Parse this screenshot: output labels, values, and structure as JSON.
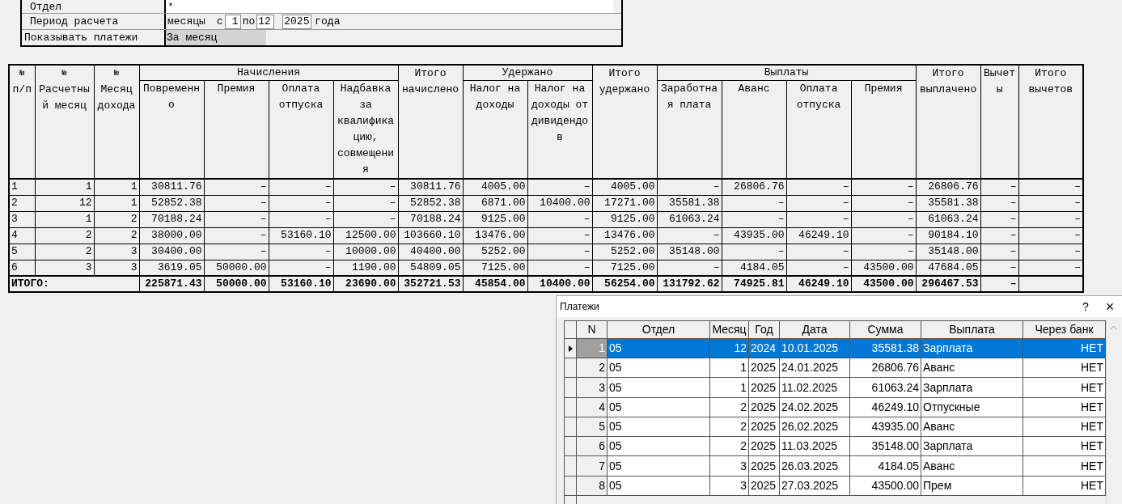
{
  "filter_form": {
    "department": {
      "label": "Отдел",
      "value": "*"
    },
    "period": {
      "label": "Период расчета",
      "months_text": "месяцы",
      "from_text": "с",
      "from": "1",
      "to_text": "по",
      "to": "12",
      "year": "2025",
      "year_text": "года"
    },
    "show_payments": {
      "label": "Показывать платежи",
      "value": "За месяц"
    }
  },
  "report_table": {
    "header_rows": [
      [
        {
          "prefix": "№",
          "label": "п/п",
          "rowspan": 2
        },
        {
          "prefix": "№",
          "label": "Расчетный месяц",
          "rowspan": 2
        },
        {
          "prefix": "№",
          "label": "Месяц дохода",
          "rowspan": 2
        },
        {
          "label": "Начисления",
          "colspan": 4
        },
        {
          "label": "Итого начислено",
          "rowspan": 2
        },
        {
          "label": "Удержано",
          "colspan": 2
        },
        {
          "label": "Итого удержано",
          "rowspan": 2
        },
        {
          "label": "Выплаты",
          "colspan": 4
        },
        {
          "label": "Итого выплачено",
          "rowspan": 2
        },
        {
          "label": "Вычеты",
          "rowspan": 2
        },
        {
          "label": "Итого вычетов",
          "rowspan": 2
        }
      ],
      [
        {
          "label": "Повременно"
        },
        {
          "label": "Премия"
        },
        {
          "label": "Оплата отпуска"
        },
        {
          "label": "Надбавка за квалификацию, совмещения"
        },
        {
          "label": "Налог на доходы"
        },
        {
          "label": "Налог на доходы от дивидендов"
        },
        {
          "label": "Заработная плата"
        },
        {
          "label": "Аванс"
        },
        {
          "label": "Оплата отпуска"
        },
        {
          "label": "Премия"
        }
      ]
    ],
    "rows": [
      [
        "1",
        "1",
        "1",
        "30811.76",
        "–",
        "–",
        "–",
        "30811.76",
        "4005.00",
        "–",
        "4005.00",
        "–",
        "26806.76",
        "–",
        "–",
        "26806.76",
        "–",
        "–"
      ],
      [
        "2",
        "12",
        "1",
        "52852.38",
        "–",
        "–",
        "–",
        "52852.38",
        "6871.00",
        "10400.00",
        "17271.00",
        "35581.38",
        "–",
        "–",
        "–",
        "35581.38",
        "–",
        "–"
      ],
      [
        "3",
        "1",
        "2",
        "70188.24",
        "–",
        "–",
        "–",
        "70188.24",
        "9125.00",
        "–",
        "9125.00",
        "61063.24",
        "–",
        "–",
        "–",
        "61063.24",
        "–",
        "–"
      ],
      [
        "4",
        "2",
        "2",
        "38000.00",
        "–",
        "53160.10",
        "12500.00",
        "103660.10",
        "13476.00",
        "–",
        "13476.00",
        "–",
        "43935.00",
        "46249.10",
        "–",
        "90184.10",
        "–",
        "–"
      ],
      [
        "5",
        "2",
        "3",
        "30400.00",
        "–",
        "–",
        "10000.00",
        "40400.00",
        "5252.00",
        "–",
        "5252.00",
        "35148.00",
        "–",
        "–",
        "–",
        "35148.00",
        "–",
        "–"
      ],
      [
        "6",
        "3",
        "3",
        "3619.05",
        "50000.00",
        "–",
        "1190.00",
        "54809.05",
        "7125.00",
        "–",
        "7125.00",
        "–",
        "4184.05",
        "–",
        "43500.00",
        "47684.05",
        "–",
        "–"
      ]
    ],
    "total": {
      "label": "ИТОГО:",
      "values": [
        "225871.43",
        "50000.00",
        "53160.10",
        "23690.00",
        "352721.53",
        "45854.00",
        "10400.00",
        "56254.00",
        "131792.62",
        "74925.81",
        "46249.10",
        "43500.00",
        "296467.53",
        "–"
      ]
    }
  },
  "payments_dialog": {
    "title": "Платежи",
    "help": "?",
    "close": "×",
    "columns": [
      "N",
      "Отдел",
      "Месяц",
      "Год",
      "Дата",
      "Сумма",
      "Выплата",
      "Через банк"
    ],
    "rows": [
      {
        "cells": [
          "1",
          "05",
          "12",
          "2024",
          "10.01.2025",
          "35581.38",
          "Зарплата",
          "НЕТ"
        ],
        "selected": true
      },
      {
        "cells": [
          "2",
          "05",
          "1",
          "2025",
          "24.01.2025",
          "26806.76",
          "Аванс",
          "НЕТ"
        ],
        "selected": false
      },
      {
        "cells": [
          "3",
          "05",
          "1",
          "2025",
          "11.02.2025",
          "61063.24",
          "Зарплата",
          "НЕТ"
        ],
        "selected": false
      },
      {
        "cells": [
          "4",
          "05",
          "2",
          "2025",
          "24.02.2025",
          "46249.10",
          "Отпускные",
          "НЕТ"
        ],
        "selected": false
      },
      {
        "cells": [
          "5",
          "05",
          "2",
          "2025",
          "26.02.2025",
          "43935.00",
          "Аванс",
          "НЕТ"
        ],
        "selected": false
      },
      {
        "cells": [
          "6",
          "05",
          "2",
          "2025",
          "11.03.2025",
          "35148.00",
          "Зарплата",
          "НЕТ"
        ],
        "selected": false
      },
      {
        "cells": [
          "7",
          "05",
          "3",
          "2025",
          "26.03.2025",
          "4184.05",
          "Аванс",
          "НЕТ"
        ],
        "selected": false
      },
      {
        "cells": [
          "8",
          "05",
          "3",
          "2025",
          "27.03.2025",
          "43500.00",
          "Прем",
          "НЕТ"
        ],
        "selected": false
      }
    ]
  }
}
